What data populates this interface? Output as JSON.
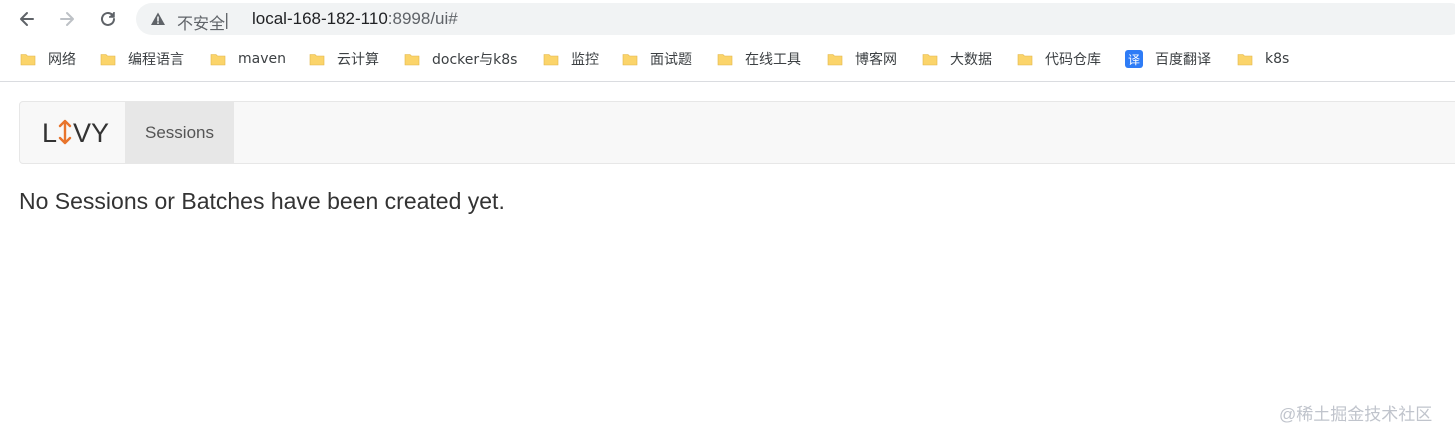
{
  "browser": {
    "security_label": "不安全",
    "separator": "|",
    "url_host": "local-168-182-110",
    "url_rest": ":8998/ui#"
  },
  "bookmarks": [
    {
      "label": "网络",
      "icon": "folder-icon"
    },
    {
      "label": "编程语言",
      "icon": "folder-icon"
    },
    {
      "label": "maven",
      "icon": "folder-icon"
    },
    {
      "label": "云计算",
      "icon": "folder-icon"
    },
    {
      "label": "docker与k8s",
      "icon": "folder-icon"
    },
    {
      "label": "监控",
      "icon": "folder-icon"
    },
    {
      "label": "面试题",
      "icon": "folder-icon"
    },
    {
      "label": "在线工具",
      "icon": "folder-icon"
    },
    {
      "label": "博客网",
      "icon": "folder-icon"
    },
    {
      "label": "大数据",
      "icon": "folder-icon"
    },
    {
      "label": "代码仓库",
      "icon": "folder-icon"
    },
    {
      "label": "百度翻译",
      "icon": "fanyi-icon",
      "icon_text": "译"
    },
    {
      "label": "k8s",
      "icon": "folder-icon"
    }
  ],
  "app": {
    "brand_left": "L",
    "brand_right": "VY",
    "nav_tab": "Sessions",
    "message": "No Sessions or Batches have been created yet."
  },
  "watermark": "@稀土掘金技术社区",
  "colors": {
    "folder": "#fbd46a",
    "accent": "#e8742c",
    "fanyi": "#2e7cf6"
  }
}
